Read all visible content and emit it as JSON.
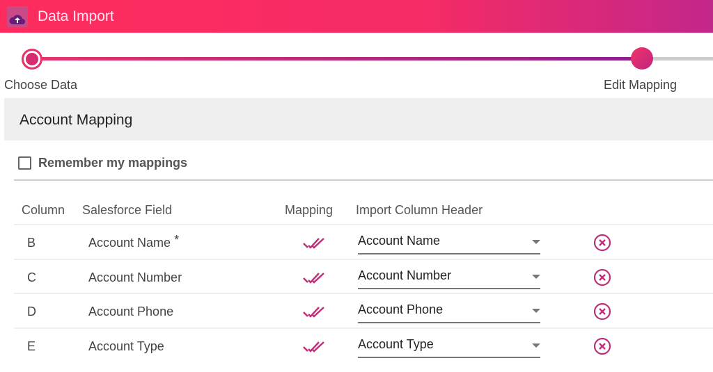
{
  "header": {
    "title": "Data Import",
    "logo_icon": "cloud-upload-icon"
  },
  "stepper": {
    "steps": [
      {
        "label": "Choose Data",
        "state": "complete"
      },
      {
        "label": "Edit Mapping",
        "state": "active"
      }
    ]
  },
  "section": {
    "title": "Account Mapping"
  },
  "remember": {
    "label": "Remember my mappings",
    "checked": false
  },
  "table": {
    "headers": [
      "Column",
      "Salesforce Field",
      "Mapping",
      "Import Column Header"
    ],
    "rows": [
      {
        "column": "B",
        "field": "Account Name",
        "required": "*",
        "header": "Account Name"
      },
      {
        "column": "C",
        "field": "Account Number",
        "required": "",
        "header": "Account Number"
      },
      {
        "column": "D",
        "field": "Account Phone",
        "required": "",
        "header": "Account Phone"
      },
      {
        "column": "E",
        "field": "Account Type",
        "required": "",
        "header": "Account Type"
      }
    ]
  },
  "colors": {
    "accent": "#fe2c5e",
    "accent2": "#c2278a",
    "icon": "#c0307a"
  }
}
